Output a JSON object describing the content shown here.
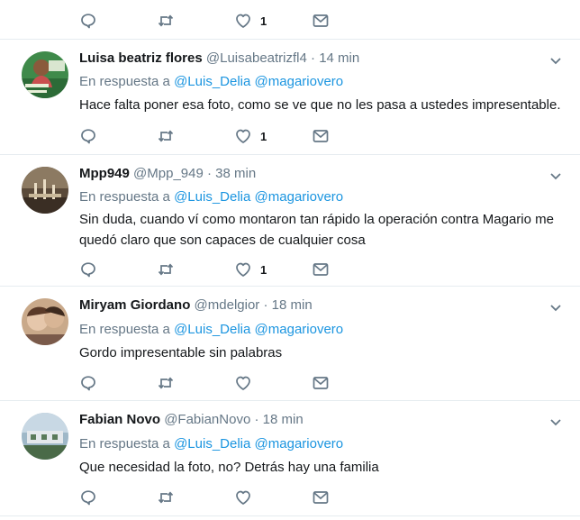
{
  "reply_prefix": "En respuesta a",
  "top_actions": {
    "likes": "1"
  },
  "tweets": [
    {
      "name": "Luisa beatriz flores",
      "handle": "@Luisabeatrizfl4",
      "dot": "·",
      "time": "14 min",
      "mentions": [
        "@Luis_Delia",
        "@magariovero"
      ],
      "text": "Hace falta poner esa foto, como se ve que no les pasa a ustedes impresentable.",
      "likes": "1"
    },
    {
      "name": "Mpp949",
      "handle": "@Mpp_949",
      "dot": "·",
      "time": "38 min",
      "mentions": [
        "@Luis_Delia",
        "@magariovero"
      ],
      "text": "Sin duda, cuando ví como montaron tan rápido la operación contra Magario me quedó claro que son capaces de cualquier cosa",
      "likes": "1"
    },
    {
      "name": "Miryam Giordano",
      "handle": "@mdelgior",
      "dot": "·",
      "time": "18 min",
      "mentions": [
        "@Luis_Delia",
        "@magariovero"
      ],
      "text": "Gordo impresentable sin palabras",
      "likes": ""
    },
    {
      "name": "Fabian Novo",
      "handle": "@FabianNovo",
      "dot": "·",
      "time": "18 min",
      "mentions": [
        "@Luis_Delia",
        "@magariovero"
      ],
      "text": "Que necesidad la foto, no? Detrás hay una familia",
      "likes": ""
    }
  ],
  "colors": {
    "accent": "#1b95e0",
    "secondary_text": "#657786",
    "icon": "#657786",
    "divider": "#e6ecf0"
  },
  "icons": [
    "reply-icon",
    "retweet-icon",
    "like-icon",
    "message-icon",
    "chevron-down-icon"
  ]
}
